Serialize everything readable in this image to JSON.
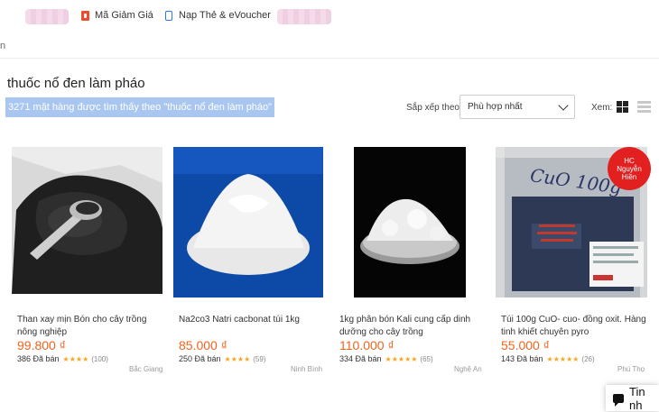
{
  "topnav": {
    "voucher_label": "Mã Giảm Giá",
    "topup_label": "Nạp Thẻ & eVoucher"
  },
  "edge_text": "n",
  "search": {
    "query": "thuốc nổ đen làm pháo",
    "result_count_text": "3271 mặt hàng được tìm thấy theo \"thuốc nổ đen làm pháo\""
  },
  "sort": {
    "label": "Sắp xếp theo:",
    "selected": "Phù hợp nhất"
  },
  "view": {
    "label": "Xem:",
    "mode": "grid"
  },
  "products": [
    {
      "name": "Than xay mịn Bón cho cây trồng nông nghiệp",
      "price": "99.800 ₫",
      "sold": "386 Đã bán",
      "stars": "★★★★",
      "reviews": "(100)",
      "location": "Bắc Giang",
      "image": "black-charcoal-powder"
    },
    {
      "name": "Na2co3 Natri cacbonat túi 1kg",
      "price": "85.000 ₫",
      "sold": "250 Đã bán",
      "stars": "★★★★",
      "reviews": "(59)",
      "location": "Ninh Bình",
      "image": "white-powder-blue-background"
    },
    {
      "name": "1kg phân bón Kali cung cấp dinh dưỡng cho cây trồng",
      "price": "110.000 ₫",
      "sold": "334 Đã bán",
      "stars": "★★★★★",
      "reviews": "(65)",
      "location": "Nghệ An",
      "image": "white-powder-plate"
    },
    {
      "name": "Túi 100g CuO- cuo- đồng oxit. Hàng tinh khiết chuyên pyro",
      "price": "55.000 ₫",
      "sold": "143 Đã bán",
      "stars": "★★★★★",
      "reviews": "(26)",
      "location": "Phú Thọ",
      "image": "black-powder-bag"
    }
  ],
  "badge": {
    "line1": "HC",
    "line2": "Nguyễn",
    "line3": "Hiền"
  },
  "bag_label": "CuO 100g",
  "chat": {
    "label": "Tin nh"
  },
  "colors": {
    "price": "#f0641e",
    "star": "#f5a623",
    "highlight": "#a8c6f0"
  }
}
